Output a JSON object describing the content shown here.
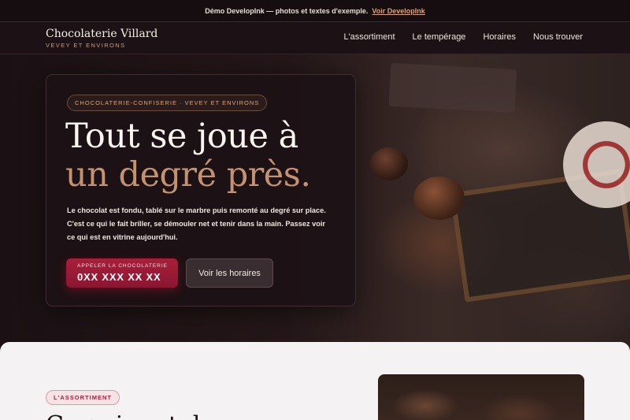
{
  "topbar": {
    "notice": "Démo DevelopInk — photos et textes d'exemple.",
    "link_label": "Voir DevelopInk"
  },
  "brand": {
    "name": "Chocolaterie Villard",
    "tagline": "VEVEY ET ENVIRONS"
  },
  "nav": {
    "items": [
      {
        "label": "L'assortiment"
      },
      {
        "label": "Le tempérage"
      },
      {
        "label": "Horaires"
      },
      {
        "label": "Nous trouver"
      }
    ]
  },
  "hero": {
    "eyebrow": "CHOCOLATERIE-CONFISERIE · VEVEY ET ENVIRONS",
    "headline_line1": "Tout se joue à",
    "headline_line2": "un degré près.",
    "text": "Le chocolat est fondu, tablé sur le marbre puis remonté au degré sur place. C'est ce qui le fait briller, se démouler net et tenir dans la main. Passez voir ce qui est en vitrine aujourd'hui.",
    "call_button": {
      "label": "APPELER LA CHOCOLATERIE",
      "number": "0XX XXX XX XX"
    },
    "hours_button_label": "Voir les horaires"
  },
  "section": {
    "eyebrow": "L'ASSORTIMENT",
    "heading": "Ce qui sort de nos"
  },
  "colors": {
    "accent": "#a81f3a",
    "gold": "#c49270",
    "dark_bg": "#1a1013"
  }
}
